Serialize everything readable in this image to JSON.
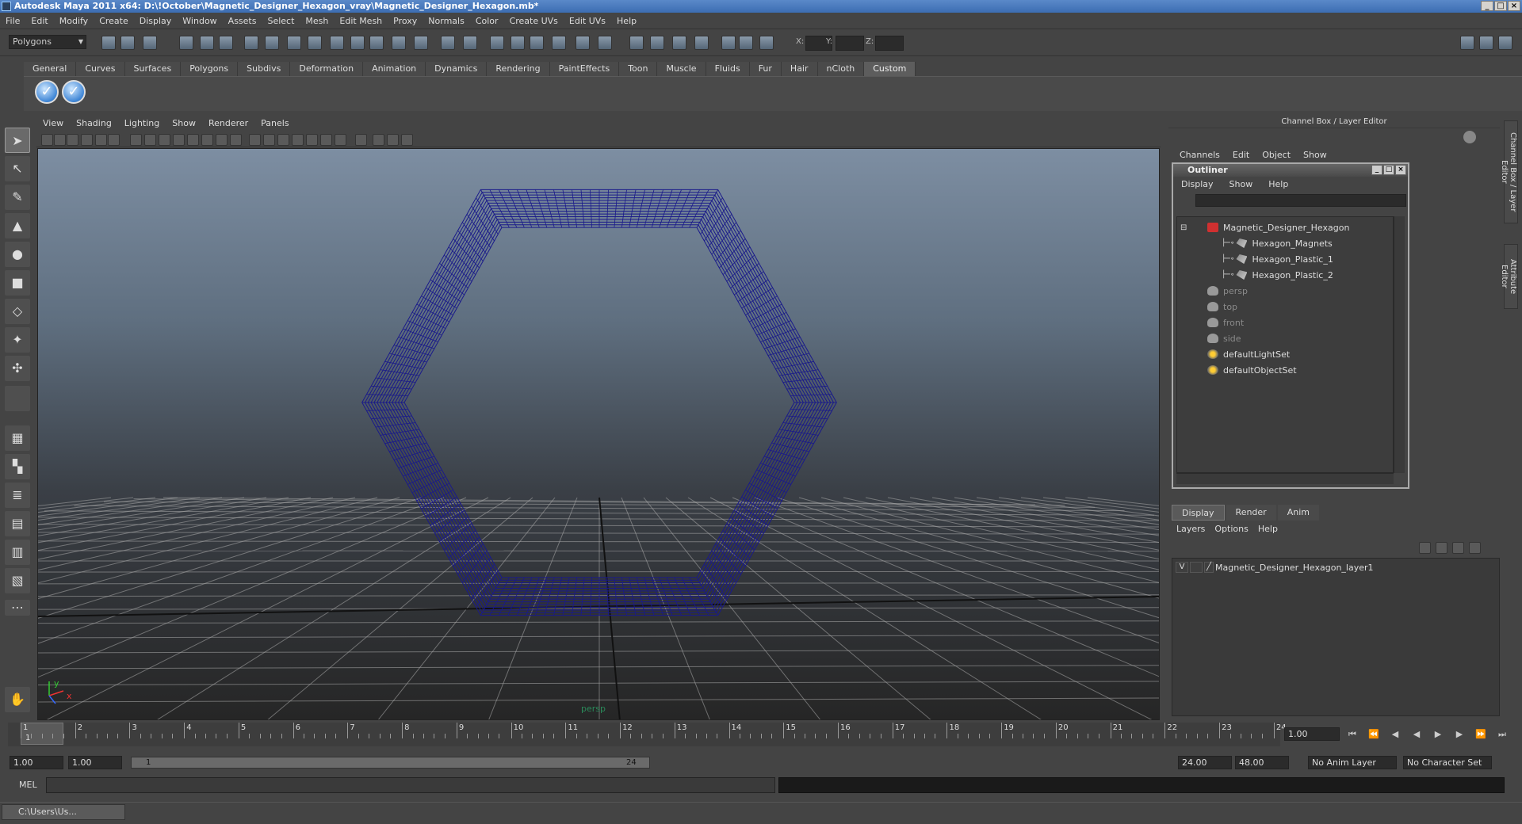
{
  "window": {
    "title": "Autodesk Maya 2011 x64: D:\\!October\\Magnetic_Designer_Hexagon_vray\\Magnetic_Designer_Hexagon.mb*"
  },
  "menubar": [
    "File",
    "Edit",
    "Modify",
    "Create",
    "Display",
    "Window",
    "Assets",
    "Select",
    "Mesh",
    "Edit Mesh",
    "Proxy",
    "Normals",
    "Color",
    "Create UVs",
    "Edit UVs",
    "Help"
  ],
  "statusline": {
    "mode": "Polygons",
    "x_label": "X:",
    "y_label": "Y:",
    "z_label": "Z:"
  },
  "shelf": {
    "tabs": [
      "General",
      "Curves",
      "Surfaces",
      "Polygons",
      "Subdivs",
      "Deformation",
      "Animation",
      "Dynamics",
      "Rendering",
      "PaintEffects",
      "Toon",
      "Muscle",
      "Fluids",
      "Fur",
      "Hair",
      "nCloth",
      "Custom"
    ],
    "active": "Custom"
  },
  "viewport": {
    "menu": [
      "View",
      "Shading",
      "Lighting",
      "Show",
      "Renderer",
      "Panels"
    ],
    "camera_label": "persp",
    "axis_y": "y",
    "axis_x": "x",
    "wire_color": "#1a1a8a"
  },
  "channelbox": {
    "title": "Channel Box / Layer Editor",
    "menu": [
      "Channels",
      "Edit",
      "Object",
      "Show"
    ],
    "side_tabs": [
      "Channel Box / Layer Editor",
      "Attribute Editor"
    ]
  },
  "outliner": {
    "title": "Outliner",
    "menu": [
      "Display",
      "Show",
      "Help"
    ],
    "items": [
      {
        "label": "Magnetic_Designer_Hexagon",
        "icon": "group-icon",
        "indent": 0,
        "dim": false
      },
      {
        "label": "Hexagon_Magnets",
        "icon": "mesh-icon",
        "indent": 1,
        "dim": false
      },
      {
        "label": "Hexagon_Plastic_1",
        "icon": "mesh-icon",
        "indent": 1,
        "dim": false
      },
      {
        "label": "Hexagon_Plastic_2",
        "icon": "mesh-icon",
        "indent": 1,
        "dim": false
      },
      {
        "label": "persp",
        "icon": "camera-icon",
        "indent": 0,
        "dim": true
      },
      {
        "label": "top",
        "icon": "camera-icon",
        "indent": 0,
        "dim": true
      },
      {
        "label": "front",
        "icon": "camera-icon",
        "indent": 0,
        "dim": true
      },
      {
        "label": "side",
        "icon": "camera-icon",
        "indent": 0,
        "dim": true
      },
      {
        "label": "defaultLightSet",
        "icon": "set-icon",
        "indent": 0,
        "dim": false
      },
      {
        "label": "defaultObjectSet",
        "icon": "set-icon",
        "indent": 0,
        "dim": false
      }
    ]
  },
  "layer_editor": {
    "tabs": [
      "Display",
      "Render",
      "Anim"
    ],
    "active": "Display",
    "menu": [
      "Layers",
      "Options",
      "Help"
    ],
    "layer": {
      "visible": "V",
      "name": "Magnetic_Designer_Hexagon_layer1"
    }
  },
  "timeline": {
    "ticks": [
      "1",
      "2",
      "3",
      "4",
      "5",
      "6",
      "7",
      "8",
      "9",
      "10",
      "11",
      "12",
      "13",
      "14",
      "15",
      "16",
      "17",
      "18",
      "19",
      "20",
      "21",
      "22",
      "23",
      "24"
    ],
    "current_frame_marker": "1",
    "current_time": "1.00"
  },
  "range": {
    "start": "1.00",
    "playback_start": "1.00",
    "slider_min": "1",
    "slider_max": "24",
    "playback_end": "24.00",
    "end": "48.00",
    "anim_layer": "No Anim Layer",
    "character_set": "No Character Set"
  },
  "cmdline": {
    "label": "MEL"
  },
  "taskbar": {
    "item": "C:\\Users\\Us..."
  }
}
